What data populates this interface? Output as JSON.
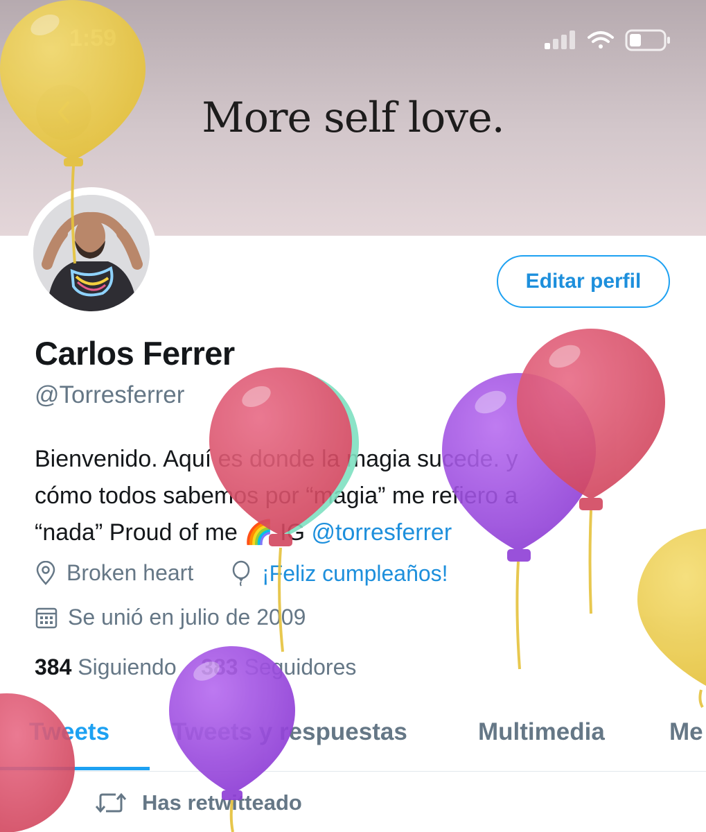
{
  "status_bar": {
    "time": "1:59"
  },
  "banner": {
    "text": "More self love."
  },
  "profile": {
    "edit_button": "Editar perfil",
    "name": "Carlos Ferrer",
    "handle": "@Torresferrer",
    "bio_line1": "Bienvenido. Aquí es donde la magia sucede. y",
    "bio_line2": "cómo todos sabemos por “magia” me refiero a",
    "bio_line3_text": "“nada” Proud of me 🌈 IG ",
    "bio_line3_link": "@torresferrer",
    "location": "Broken heart",
    "birthday": "¡Feliz cumpleaños!",
    "joined": "Se unió en julio de 2009",
    "following_count": "384",
    "following_label": "Siguiendo",
    "followers_count": "383",
    "followers_label": "Seguidores"
  },
  "tabs": [
    {
      "label": "Tweets",
      "active": true
    },
    {
      "label": "Tweets y respuestas",
      "active": false
    },
    {
      "label": "Multimedia",
      "active": false
    },
    {
      "label": "Me",
      "active": false
    }
  ],
  "feed": {
    "retweet_label": "Has retwitteado"
  },
  "icons": {
    "back": "chevron-left-icon",
    "location": "location-pin-icon",
    "birthday": "balloon-icon",
    "calendar": "calendar-icon",
    "retweet": "retweet-icon"
  },
  "colors": {
    "accent": "#1da1f2",
    "secondary_text": "#657786",
    "primary_text": "#14171a"
  }
}
